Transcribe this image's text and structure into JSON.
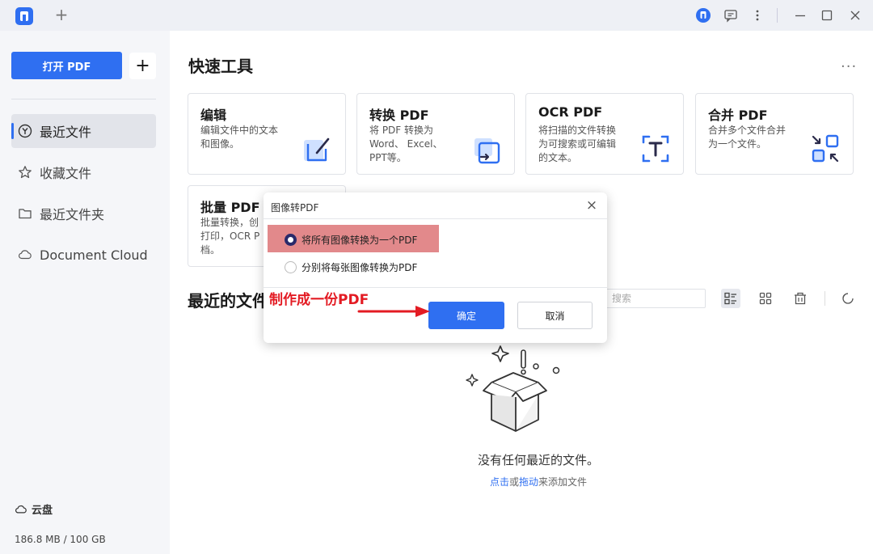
{
  "titlebar": {
    "new_tab": "+",
    "icons": [
      "app-logo-icon",
      "message-icon",
      "more-vertical-icon",
      "minimize-icon",
      "maximize-icon",
      "close-icon"
    ]
  },
  "sidebar": {
    "open_button": "打开 PDF",
    "add_button": "+",
    "items": [
      {
        "label": "最近文件",
        "icon": "recent-icon",
        "active": true
      },
      {
        "label": "收藏文件",
        "icon": "star-icon",
        "active": false
      },
      {
        "label": "最近文件夹",
        "icon": "folder-icon",
        "active": false
      },
      {
        "label": "Document Cloud",
        "icon": "cloud-icon",
        "active": false
      }
    ],
    "cloud_label": "云盘",
    "storage": "186.8 MB / 100 GB"
  },
  "quick_tools": {
    "title": "快速工具",
    "more": "···",
    "cards": [
      {
        "title": "编辑",
        "desc": "编辑文件中的文本\n和图像。",
        "icon": "edit-icon"
      },
      {
        "title": "转换 PDF",
        "desc": "将 PDF 转换为\nWord、 Excel、\nPPT等。",
        "icon": "convert-icon"
      },
      {
        "title": "OCR PDF",
        "desc": "将扫描的文件转换\n为可搜索或可编辑\n的文本。",
        "icon": "ocr-icon"
      },
      {
        "title": "合并 PDF",
        "desc": "合并多个文件合并\n为一个文件。",
        "icon": "merge-icon"
      },
      {
        "title": "批量 PDF",
        "desc": "批量转换，创\n打印，OCR P\n档。",
        "icon": "batch-icon"
      }
    ]
  },
  "recent": {
    "title": "最近的文件",
    "search_placeholder": "搜索",
    "empty_title": "没有任何最近的文件。",
    "empty_click": "点击",
    "empty_or": "或",
    "empty_drag": "拖动",
    "empty_rest": "来添加文件"
  },
  "dialog": {
    "title": "图像转PDF",
    "close": "×",
    "options": [
      {
        "label": "将所有图像转换为一个PDF",
        "checked": true
      },
      {
        "label": "分别将每张图像转换为PDF",
        "checked": false
      }
    ],
    "ok": "确定",
    "cancel": "取消"
  },
  "annotation": {
    "text": "制作成一份PDF",
    "color": "#e31b23"
  },
  "colors": {
    "accent": "#2f6ff1",
    "highlight": "#e2898b"
  }
}
